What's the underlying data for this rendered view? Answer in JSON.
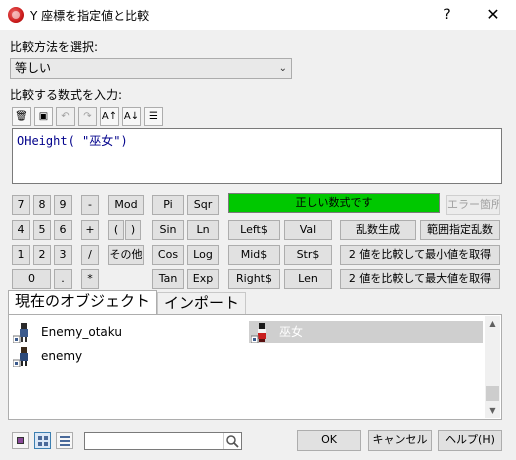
{
  "window": {
    "title": "Y 座標を指定値と比較",
    "help": "?",
    "close": "✕"
  },
  "compare_label": "比較方法を選択:",
  "compare_value": "等しい",
  "formula_label": "比較する数式を入力:",
  "toolbar": {
    "b1": "🗑",
    "b2": "▣",
    "b3": "↶",
    "b4": "↷",
    "b5": "A↑",
    "b6": "A↓",
    "b7": "☰"
  },
  "formula": "OHeight( \"巫女\")",
  "keypad": {
    "k7": "7",
    "k8": "8",
    "k9": "9",
    "minus": "-",
    "mod": "Mod",
    "pi": "Pi",
    "sqr": "Sqr",
    "k4": "4",
    "k5": "5",
    "k6": "6",
    "plus": "+",
    "lparen": "(",
    "rparen": ")",
    "sin": "Sin",
    "ln": "Ln",
    "left": "Left$",
    "val": "Val",
    "rand": "乱数生成",
    "range_rand": "範囲指定乱数",
    "k1": "1",
    "k2": "2",
    "k3": "3",
    "div": "/",
    "other": "その他",
    "cos": "Cos",
    "log": "Log",
    "mid": "Mid$",
    "str": "Str$",
    "min": "2 値を比較して最小値を取得",
    "k0": "0",
    "dot": ".",
    "mul": "*",
    "tan": "Tan",
    "exp": "Exp",
    "right": "Right$",
    "len": "Len",
    "max": "2 値を比較して最大値を取得"
  },
  "status": {
    "ok": "正しい数式です",
    "error_btn": "エラー箇所",
    "ok_color": "#00c800"
  },
  "tabs": {
    "current": "現在のオブジェクト",
    "import": "インポート"
  },
  "objects": [
    {
      "name": "Enemy_otaku"
    },
    {
      "name": "巫女"
    },
    {
      "name": "enemy"
    }
  ],
  "buttons": {
    "ok": "OK",
    "cancel": "キャンセル",
    "help": "ヘルプ(H)"
  }
}
